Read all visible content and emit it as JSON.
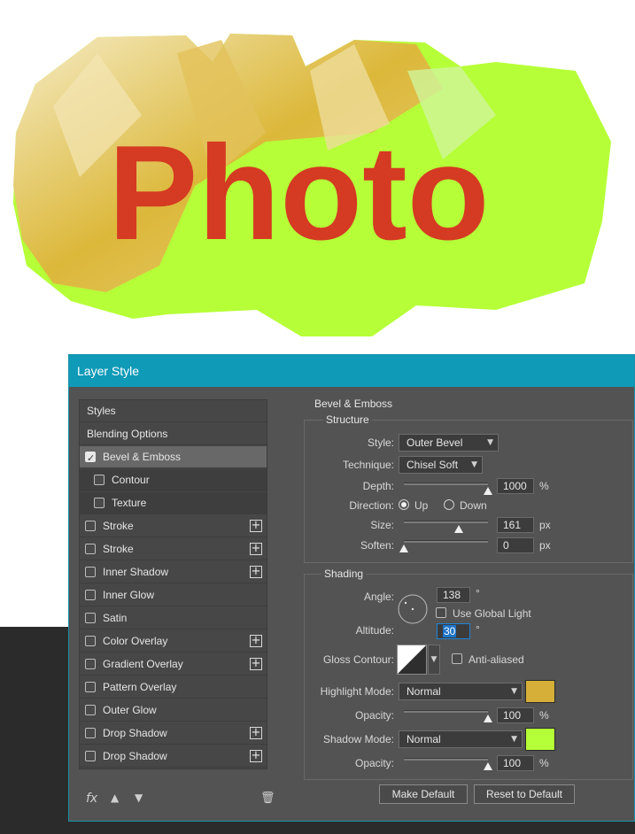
{
  "canvas": {
    "art_text": "Photo",
    "text_color": "#d53a22",
    "highlight_color": "#dcb83a",
    "shadow_color": "#b6ff38"
  },
  "dialog": {
    "title": "Layer Style",
    "left_panel": {
      "items": [
        {
          "label": "Styles",
          "type": "header",
          "checked": false,
          "plus": false
        },
        {
          "label": "Blending Options",
          "type": "header",
          "checked": false,
          "plus": false
        },
        {
          "label": "Bevel & Emboss",
          "type": "effect",
          "checked": true,
          "plus": false,
          "selected": true
        },
        {
          "label": "Contour",
          "type": "sub",
          "checked": false,
          "plus": false
        },
        {
          "label": "Texture",
          "type": "sub",
          "checked": false,
          "plus": false
        },
        {
          "label": "Stroke",
          "type": "effect",
          "checked": false,
          "plus": true
        },
        {
          "label": "Stroke",
          "type": "effect",
          "checked": false,
          "plus": true
        },
        {
          "label": "Inner Shadow",
          "type": "effect",
          "checked": false,
          "plus": true
        },
        {
          "label": "Inner Glow",
          "type": "effect",
          "checked": false,
          "plus": false
        },
        {
          "label": "Satin",
          "type": "effect",
          "checked": false,
          "plus": false
        },
        {
          "label": "Color Overlay",
          "type": "effect",
          "checked": false,
          "plus": true
        },
        {
          "label": "Gradient Overlay",
          "type": "effect",
          "checked": false,
          "plus": true
        },
        {
          "label": "Pattern Overlay",
          "type": "effect",
          "checked": false,
          "plus": false
        },
        {
          "label": "Outer Glow",
          "type": "effect",
          "checked": false,
          "plus": false
        },
        {
          "label": "Drop Shadow",
          "type": "effect",
          "checked": false,
          "plus": true
        },
        {
          "label": "Drop Shadow",
          "type": "effect",
          "checked": false,
          "plus": true
        }
      ],
      "footer": {
        "fx_label": "fx",
        "up_icon": "arrow-up-icon",
        "down_icon": "arrow-down-icon",
        "trash_icon": "trash-icon"
      }
    },
    "bevel": {
      "section_title": "Bevel & Emboss",
      "structure": {
        "title": "Structure",
        "style_label": "Style:",
        "style_value": "Outer Bevel",
        "technique_label": "Technique:",
        "technique_value": "Chisel Soft",
        "depth_label": "Depth:",
        "depth_value": "1000",
        "depth_unit": "%",
        "depth_fraction": 1.0,
        "direction_label": "Direction:",
        "dir_up": "Up",
        "dir_down": "Down",
        "direction_selected": "Up",
        "size_label": "Size:",
        "size_value": "161",
        "size_unit": "px",
        "size_fraction": 0.65,
        "soften_label": "Soften:",
        "soften_value": "0",
        "soften_unit": "px",
        "soften_fraction": 0.0
      },
      "shading": {
        "title": "Shading",
        "angle_label": "Angle:",
        "angle_value": "138",
        "angle_unit": "°",
        "use_global_light": "Use Global Light",
        "altitude_label": "Altitude:",
        "altitude_value": "30",
        "altitude_unit": "°",
        "gloss_label": "Gloss Contour:",
        "anti_aliased": "Anti-aliased",
        "highlight_mode_label": "Highlight Mode:",
        "highlight_mode_value": "Normal",
        "highlight_color": "#d5af38",
        "opacity_label": "Opacity:",
        "highlight_opacity": "100",
        "opacity_unit": "%",
        "shadow_mode_label": "Shadow Mode:",
        "shadow_mode_value": "Normal",
        "shadow_color": "#b5ff38",
        "shadow_opacity": "100"
      },
      "buttons": {
        "make_default": "Make Default",
        "reset_default": "Reset to Default"
      }
    }
  }
}
